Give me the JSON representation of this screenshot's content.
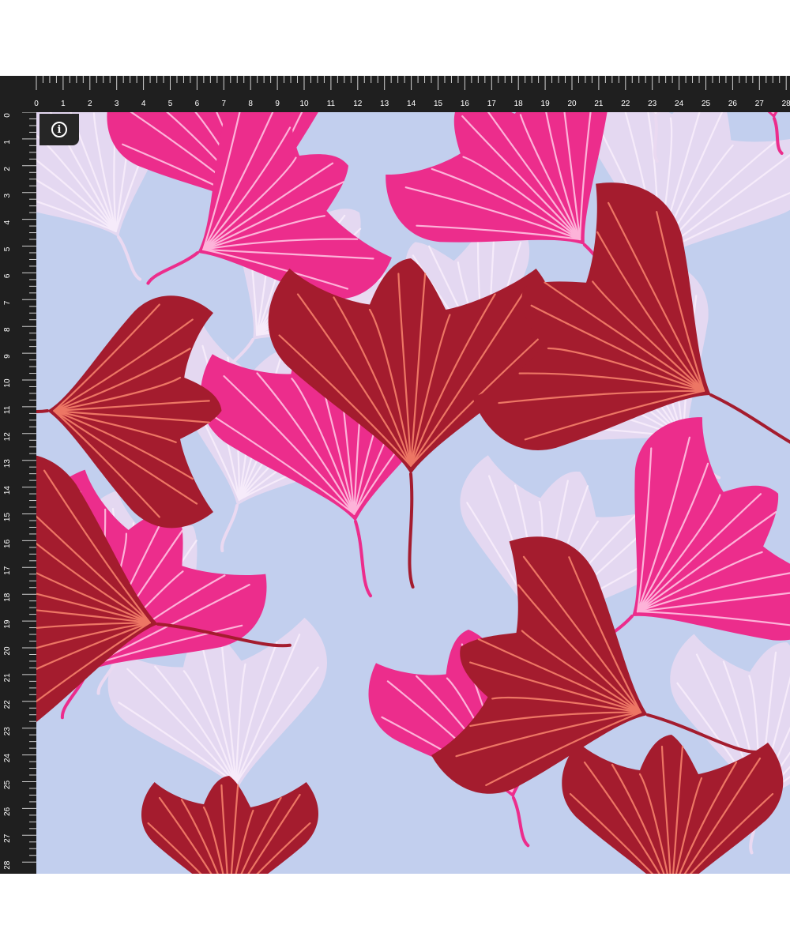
{
  "ruler": {
    "unit_marks_top": [
      "0",
      "1",
      "2",
      "3",
      "4",
      "5",
      "6",
      "7",
      "8",
      "9",
      "10",
      "11",
      "12",
      "13",
      "14",
      "15",
      "16",
      "17",
      "18",
      "19",
      "20",
      "21",
      "22",
      "23",
      "24",
      "25",
      "26",
      "27",
      "28"
    ],
    "unit_marks_left": [
      "0",
      "1",
      "2",
      "3",
      "4",
      "5",
      "6",
      "7",
      "8",
      "9",
      "10",
      "11",
      "12",
      "13",
      "14",
      "15",
      "16",
      "17",
      "18",
      "19",
      "20",
      "21",
      "22",
      "23",
      "24",
      "25",
      "26",
      "27",
      "28"
    ]
  },
  "info_button": {
    "icon": "info-icon",
    "glyph": "i"
  },
  "fabric": {
    "pattern": "ginkgo-leaf",
    "colors": {
      "background": "#c2cfee",
      "ghost_leaf": "#ead9f1",
      "pink_leaf": "#ec2d8c",
      "pink_vein": "#ffc2e2",
      "red_leaf": "#a41c2e",
      "red_vein": "#f5806a",
      "ruler": "#1f1f1f"
    }
  }
}
